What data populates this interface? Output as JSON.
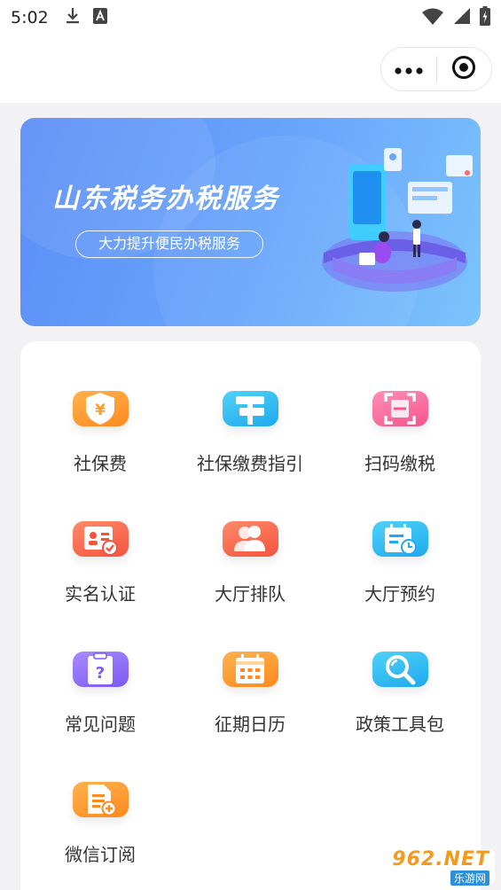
{
  "status_bar": {
    "time": "5:02",
    "left_icons": [
      "download-icon",
      "font-a-icon"
    ],
    "right_icons": [
      "wifi-icon",
      "signal-icon",
      "battery-charging-icon"
    ]
  },
  "nav": {
    "capsule_icons": [
      "more-dots-icon",
      "close-target-icon"
    ]
  },
  "banner": {
    "title": "山东税务办税服务",
    "subtitle": "大力提升便民办税服务"
  },
  "services": [
    {
      "label": "社保费",
      "icon": "shield-yen-icon",
      "color_from": "#ffb24d",
      "color_to": "#ff8a1f"
    },
    {
      "label": "社保缴费指引",
      "icon": "signpost-icon",
      "color_from": "#4fd2f8",
      "color_to": "#1fa9ee"
    },
    {
      "label": "扫码缴税",
      "icon": "scan-icon",
      "color_from": "#ff8fb4",
      "color_to": "#f5548c"
    },
    {
      "label": "实名认证",
      "icon": "id-card-check-icon",
      "color_from": "#ff8a6a",
      "color_to": "#f4543e"
    },
    {
      "label": "大厅排队",
      "icon": "people-icon",
      "color_from": "#ff8a6a",
      "color_to": "#f4543e"
    },
    {
      "label": "大厅预约",
      "icon": "calendar-clock-icon",
      "color_from": "#4fd2f8",
      "color_to": "#1fa9ee"
    },
    {
      "label": "常见问题",
      "icon": "question-clipboard-icon",
      "color_from": "#a98bff",
      "color_to": "#7b59f4"
    },
    {
      "label": "征期日历",
      "icon": "calendar-grid-icon",
      "color_from": "#ffb24d",
      "color_to": "#ff8a1f"
    },
    {
      "label": "政策工具包",
      "icon": "magnifier-icon",
      "color_from": "#4fd2f8",
      "color_to": "#1fa9ee"
    },
    {
      "label": "微信订阅",
      "icon": "document-add-icon",
      "color_from": "#ffb24d",
      "color_to": "#ff8a1f"
    }
  ],
  "watermark": {
    "top": "962.NET",
    "bottom": "乐游网"
  }
}
